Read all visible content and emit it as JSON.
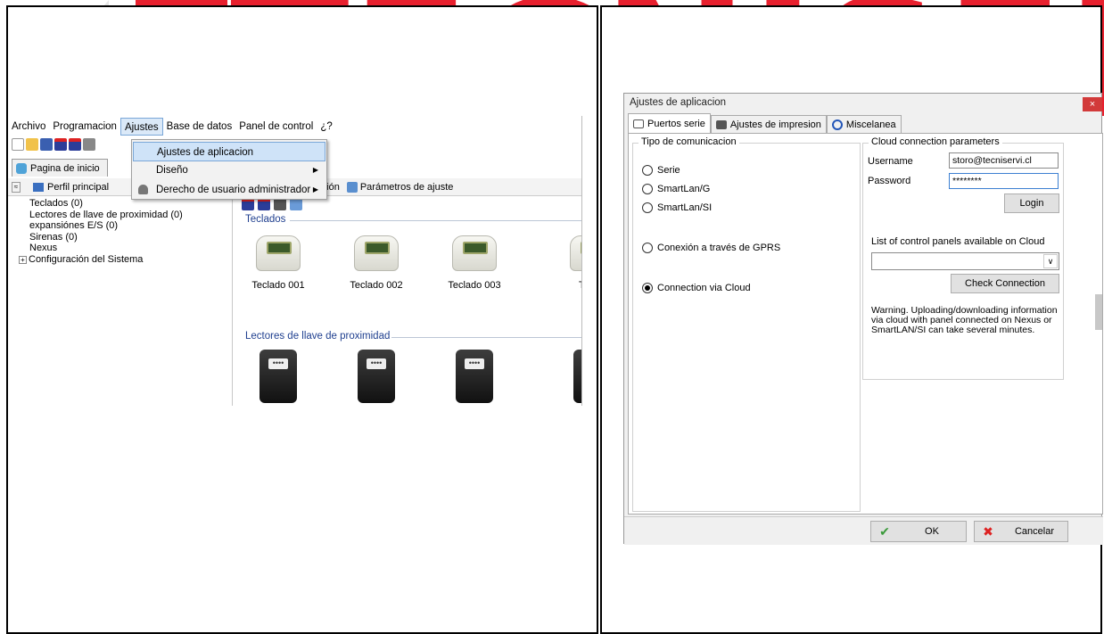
{
  "watermark": {
    "text": "TECNISERVI",
    "color": "#e8202e"
  },
  "left": {
    "menu": [
      "Archivo",
      "Programacion",
      "Ajustes",
      "Base de datos",
      "Panel de control",
      "¿?"
    ],
    "tabs": [
      "Pagina de inicio"
    ],
    "perfil_label": "Perfil principal",
    "row_tabs": [
      "lación",
      "Parámetros de ajuste"
    ],
    "tree": [
      "Teclados (0)",
      "Lectores de llave de proximidad (0)",
      "expansiónes E/S (0)",
      "Sirenas (0)",
      "Nexus",
      "Configuración del Sistema"
    ],
    "sections": {
      "teclados_title": "Teclados",
      "lectores_title": "Lectores de llave de proximidad"
    },
    "keypads": [
      "Teclado 001",
      "Teclado 002",
      "Teclado 003",
      "Te"
    ],
    "dropdown": [
      {
        "label": "Ajustes de aplicacion",
        "highlighted": true
      },
      {
        "label": "Diseño"
      },
      {
        "label": "Derecho de usuario administrador"
      }
    ],
    "reader_display": "••••"
  },
  "dialog": {
    "title": "Ajustes de aplicacion",
    "close_glyph": "×",
    "tabs": [
      "Puertos serie",
      "Ajustes de impresion",
      "Miscelanea"
    ],
    "comm_legend": "Tipo de comunicacion",
    "radios": [
      {
        "label": "Serie",
        "checked": false
      },
      {
        "label": "SmartLan/G",
        "checked": false
      },
      {
        "label": "SmartLan/SI",
        "checked": false
      },
      {
        "label": "Conexión a través de GPRS",
        "checked": false
      },
      {
        "label": "Connection via Cloud",
        "checked": true
      }
    ],
    "cloud_legend": "Cloud connection parameters",
    "username_label": "Username",
    "username_value": "storo@tecniservi.cl",
    "password_label": "Password",
    "password_value": "********",
    "login_button": "Login",
    "list_label": "List of control panels available on Cloud",
    "check_button": "Check Connection",
    "warning": "Warning. Uploading/downloading information via cloud with panel connected on Nexus or SmartLAN/SI can take several minutes.",
    "ok_button": "OK",
    "cancel_button": "Cancelar"
  }
}
